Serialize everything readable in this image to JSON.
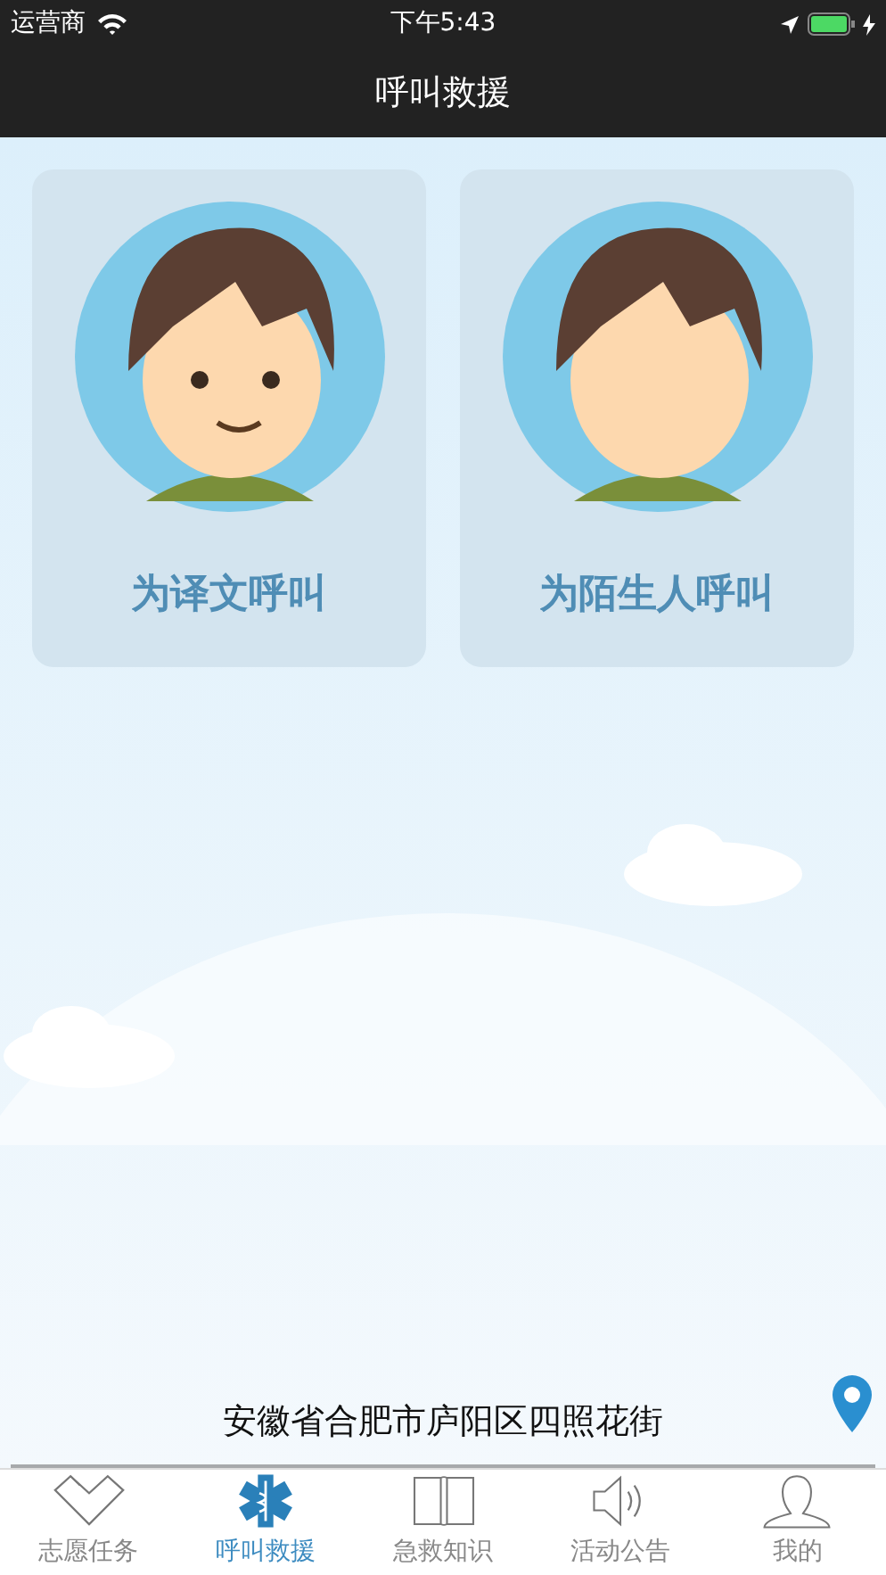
{
  "status_bar": {
    "carrier": "运营商",
    "time": "下午5:43"
  },
  "nav_bar": {
    "title": "呼叫救援"
  },
  "call_cards": [
    {
      "label": "为译文呼叫",
      "face_shown": true
    },
    {
      "label": "为陌生人呼叫",
      "face_shown": false
    }
  ],
  "location": {
    "address": "安徽省合肥市庐阳区四照花街"
  },
  "tab_bar": [
    {
      "label": "志愿任务",
      "selected": false
    },
    {
      "label": "呼叫救援",
      "selected": true
    },
    {
      "label": "急救知识",
      "selected": false
    },
    {
      "label": "活动公告",
      "selected": false
    },
    {
      "label": "我的",
      "selected": false
    }
  ]
}
